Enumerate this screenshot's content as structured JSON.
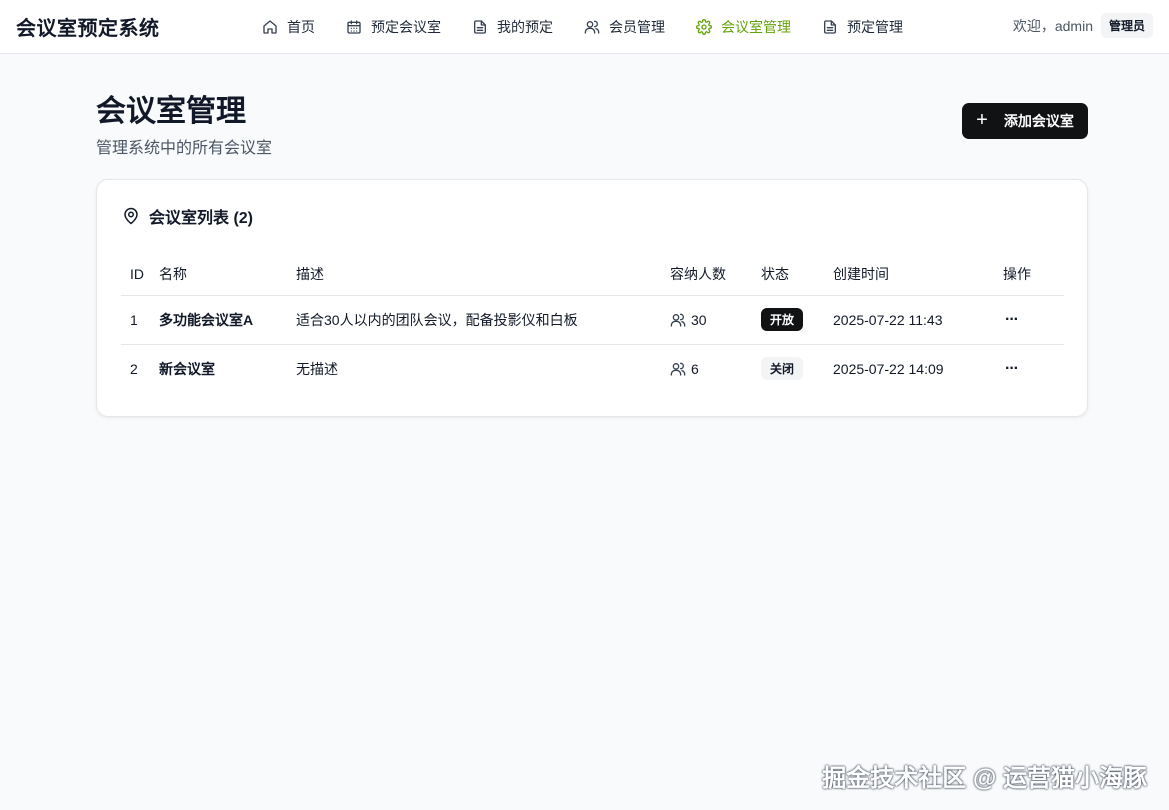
{
  "app": {
    "title": "会议室预定系统"
  },
  "nav": {
    "items": [
      {
        "label": "首页",
        "icon": "home-icon"
      },
      {
        "label": "预定会议室",
        "icon": "calendar-icon"
      },
      {
        "label": "我的预定",
        "icon": "document-icon"
      },
      {
        "label": "会员管理",
        "icon": "users-icon"
      },
      {
        "label": "会议室管理",
        "icon": "gear-icon",
        "active": true
      },
      {
        "label": "预定管理",
        "icon": "document-icon"
      }
    ]
  },
  "user": {
    "welcome": "欢迎，admin",
    "role": "管理员"
  },
  "page": {
    "title": "会议室管理",
    "subtitle": "管理系统中的所有会议室",
    "add_button": "添加会议室"
  },
  "card": {
    "title": "会议室列表 (2)"
  },
  "table": {
    "headers": {
      "id": "ID",
      "name": "名称",
      "description": "描述",
      "capacity": "容纳人数",
      "status": "状态",
      "created": "创建时间",
      "ops": "操作"
    },
    "rows": [
      {
        "id": "1",
        "name": "多功能会议室A",
        "description": "适合30人以内的团队会议，配备投影仪和白板",
        "capacity": "30",
        "status": "开放",
        "created": "2025-07-22 11:43",
        "ops": "···"
      },
      {
        "id": "2",
        "name": "新会议室",
        "description": "无描述",
        "capacity": "6",
        "status": "关闭",
        "created": "2025-07-22 14:09",
        "ops": "···"
      }
    ]
  },
  "watermark": "掘金技术社区 @ 运营猫小海豚",
  "colors": {
    "accent": "#65a30d",
    "primary_button": "#111214",
    "background": "#f9fafb"
  }
}
